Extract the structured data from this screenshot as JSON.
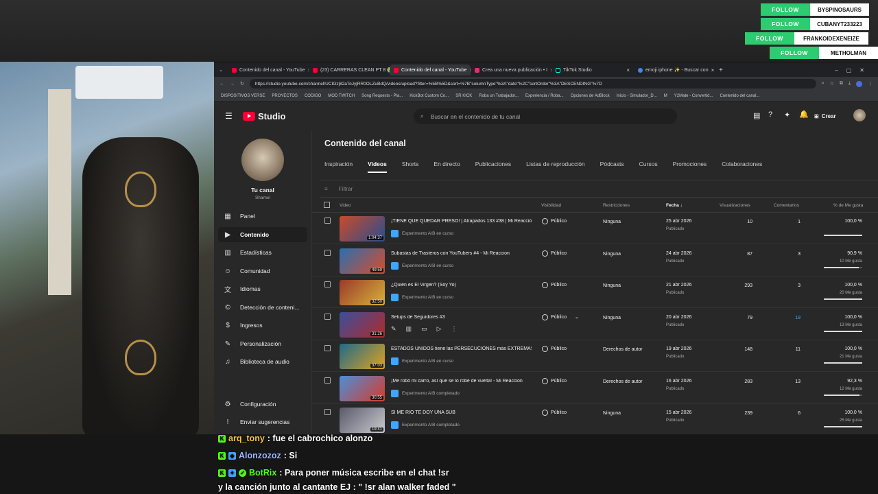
{
  "overlay": {
    "follows": [
      {
        "label": "FOLLOW",
        "name": "BYSPINOSAURS"
      },
      {
        "label": "FOLLOW",
        "name": "CUBANYT233223"
      },
      {
        "label": "FOLLOW",
        "name": "FRANKOIDEXENEIZE"
      },
      {
        "label": "FOLLOW",
        "name": "METHOLMAN"
      }
    ]
  },
  "browser": {
    "tabs": [
      {
        "label": "Contenido del canal - YouTube"
      },
      {
        "label": "(23) CARRERAS CLEAN PT 8 😭"
      },
      {
        "label": "Contenido del canal - YouTube"
      },
      {
        "label": "Crea una nueva publicación • I"
      },
      {
        "label": "TikTok Studio"
      },
      {
        "label": "emoji iphone ✨ - Buscar con"
      }
    ],
    "url": "https://studio.youtube.com/channel/UCIGzj82aToJyjRR0OLZuBdQ/videos/upload?filter=%5B%5D&sort=%7B\"columnType\"%3A\"date\"%2C\"sortOrder\"%3A\"DESCENDING\"%7D",
    "bookmarks": [
      "DISPOSITIVOS VERSE",
      "PROYECTOS",
      "CODIGO",
      "MOD TWITCH",
      "Song Requests - Pla...",
      "KickBot Custom Co...",
      "SR KICK",
      "Roba un Trabajador...",
      "Experiencia / Roba...",
      "Opciones de AdBlock",
      "Inicio - Simulador_D...",
      "M",
      "Y2Mate - Convertid...",
      "Contenido del canal..."
    ]
  },
  "studio": {
    "brand": "Studio",
    "search_placeholder": "Buscar en el contenido de tu canal",
    "create_label": "Crear",
    "channel": {
      "title": "Tu canal",
      "name": "Shamei"
    },
    "nav": [
      "Panel",
      "Contenido",
      "Estadísticas",
      "Comunidad",
      "Idiomas",
      "Detección de conteni...",
      "Ingresos",
      "Personalización",
      "Biblioteca de audio"
    ],
    "nav_bottom": [
      "Configuración",
      "Enviar sugerencias"
    ],
    "page_title": "Contenido del canal",
    "tabs": [
      "Inspiración",
      "Videos",
      "Shorts",
      "En directo",
      "Publicaciones",
      "Listas de reproducción",
      "Pódcasts",
      "Cursos",
      "Promociones",
      "Colaboraciones"
    ],
    "filter_label": "Filtrar",
    "columns": {
      "video": "Video",
      "visibility": "Visibilidad",
      "restrictions": "Restricciones",
      "date": "Fecha ↓",
      "views": "Visualizaciones",
      "comments": "Comentarios",
      "likes": "% de Me gusta"
    },
    "rows": [
      {
        "title": "¡TIENE QUE QUEDAR PRESO! | Atrapados 133 #38 | Mi Reacció...",
        "ab": "Experimento A/B en curso",
        "duration": "1:04:37",
        "visibility": "Público",
        "restriction": "Ninguna",
        "date": "25 abr 2026",
        "status": "Publicado",
        "views": "10",
        "comments": "1",
        "pct": "100,0 %",
        "likes": "",
        "ratio": 1.0
      },
      {
        "title": "Subastas de Trasteros con YouTubers #4 - Mi Reaccion",
        "ab": "Experimento A/B en curso",
        "duration": "49:59",
        "visibility": "Público",
        "restriction": "Ninguna",
        "date": "24 abr 2026",
        "status": "Publicado",
        "views": "87",
        "comments": "3",
        "pct": "90,9 %",
        "likes": "10 Me gusta",
        "ratio": 0.909
      },
      {
        "title": "¿Quién es El Virgen? (Soy Yo)",
        "ab": "Experimento A/B en curso",
        "duration": "32:50",
        "visibility": "Público",
        "restriction": "Ninguna",
        "date": "21 abr 2026",
        "status": "Publicado",
        "views": "293",
        "comments": "3",
        "pct": "100,0 %",
        "likes": "20 Me gusta",
        "ratio": 1.0
      },
      {
        "title": "Setups de Seguidores #3",
        "ab": "",
        "duration": "31:26",
        "visibility": "Público",
        "restriction": "Ninguna",
        "date": "20 abr 2026",
        "status": "Publicado",
        "views": "79",
        "comments": "19",
        "pct": "100,0 %",
        "likes": "13 Me gusta",
        "ratio": 1.0
      },
      {
        "title": "ESTADOS UNIDOS tiene las PERSECUCIONES más EXTREMAS...",
        "ab": "Experimento A/B en curso",
        "duration": "37:03",
        "visibility": "Público",
        "restriction": "Derechos de autor",
        "date": "19 abr 2026",
        "status": "Publicado",
        "views": "148",
        "comments": "11",
        "pct": "100,0 %",
        "likes": "21 Me gusta",
        "ratio": 1.0
      },
      {
        "title": "¡Me robó mi carro, así que se lo robé de vuelta! - Mi Reaccion",
        "ab": "Experimento A/B completado",
        "duration": "30:55",
        "visibility": "Público",
        "restriction": "Derechos de autor",
        "date": "16 abr 2026",
        "status": "Publicado",
        "views": "283",
        "comments": "13",
        "pct": "92,3 %",
        "likes": "12 Me gusta",
        "ratio": 0.923
      },
      {
        "title": "SI ME RÍO TE DOY UNA SUB",
        "ab": "Experimento A/B completado",
        "duration": "19:41",
        "visibility": "Público",
        "restriction": "Ninguna",
        "date": "15 abr 2026",
        "status": "Publicado",
        "views": "239",
        "comments": "6",
        "pct": "100,0 %",
        "likes": "25 Me gusta",
        "ratio": 1.0
      }
    ]
  },
  "chat": [
    {
      "user": "arq_tony",
      "color": "#f5c542",
      "text": ": fue el cabrochico alonzo"
    },
    {
      "user": "Alonzozoz",
      "color": "#9fb8ff",
      "text": ": Si"
    },
    {
      "user": "BotRix",
      "color": "#53fc18",
      "text": ": Para poner música escribe en el chat !sr"
    },
    {
      "user": "",
      "color": "#ffffff",
      "text": "y la canción junto al cantante EJ : \" !sr alan walker faded \""
    }
  ]
}
